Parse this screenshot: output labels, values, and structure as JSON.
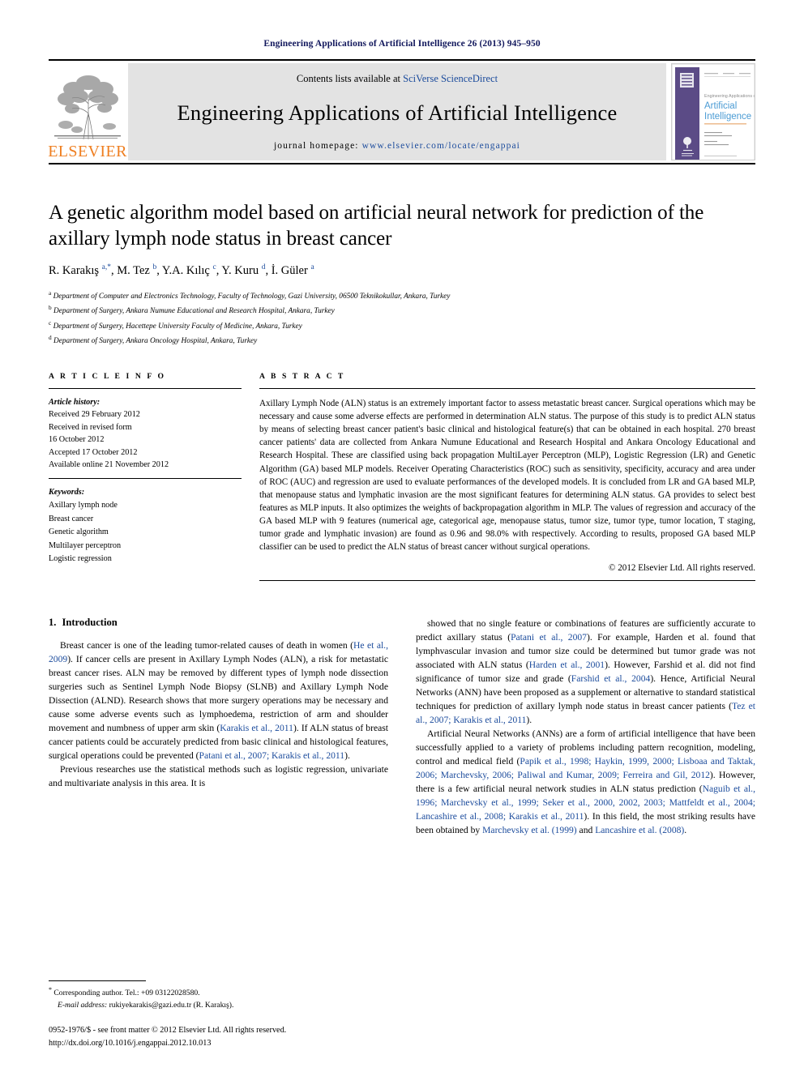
{
  "running_head": "Engineering Applications of Artificial Intelligence 26 (2013) 945–950",
  "masthead": {
    "publisher_logo_text": "ELSEVIER",
    "contents_prefix": "Contents lists available at ",
    "contents_link": "SciVerse ScienceDirect",
    "journal_title": "Engineering Applications of Artificial Intelligence",
    "homepage_prefix": "journal homepage: ",
    "homepage_url": "www.elsevier.com/locate/engappai",
    "cover": {
      "line1": "Engineering Applications of",
      "line2": "Artificial",
      "line3": "Intelligence",
      "accent_color": "#5b4b86",
      "title_color": "#4a9bd4"
    }
  },
  "article": {
    "title": "A genetic algorithm model based on artificial neural network for prediction of the axillary lymph node status in breast cancer",
    "authors_html": "R. Karakış <sup>a,*</sup>, M. Tez <sup>b</sup>, Y.A. Kılıç <sup>c</sup>, Y. Kuru <sup>d</sup>, İ. Güler <sup>a</sup>",
    "affiliations": [
      {
        "marker": "a",
        "text": "Department of Computer and Electronics Technology, Faculty of Technology, Gazi University, 06500 Teknikokullar, Ankara, Turkey"
      },
      {
        "marker": "b",
        "text": "Department of Surgery, Ankara Numune Educational and Research Hospital, Ankara, Turkey"
      },
      {
        "marker": "c",
        "text": "Department of Surgery, Hacettepe University Faculty of Medicine, Ankara, Turkey"
      },
      {
        "marker": "d",
        "text": "Department of Surgery, Ankara Oncology Hospital, Ankara, Turkey"
      }
    ]
  },
  "article_info": {
    "heading": "A R T I C L E   I N F O",
    "history_label": "Article history:",
    "history": [
      "Received 29 February 2012",
      "Received in revised form",
      "16 October 2012",
      "Accepted 17 October 2012",
      "Available online 21 November 2012"
    ],
    "keywords_label": "Keywords:",
    "keywords": [
      "Axillary lymph node",
      "Breast cancer",
      "Genetic algorithm",
      "Multilayer perceptron",
      "Logistic regression"
    ]
  },
  "abstract": {
    "heading": "A B S T R A C T",
    "text": "Axillary Lymph Node (ALN) status is an extremely important factor to assess metastatic breast cancer. Surgical operations which may be necessary and cause some adverse effects are performed in determination ALN status. The purpose of this study is to predict ALN status by means of selecting breast cancer patient's basic clinical and histological feature(s) that can be obtained in each hospital. 270 breast cancer patients' data are collected from Ankara Numune Educational and Research Hospital and Ankara Oncology Educational and Research Hospital. These are classified using back propagation MultiLayer Perceptron (MLP), Logistic Regression (LR) and Genetic Algorithm (GA) based MLP models. Receiver Operating Characteristics (ROC) such as sensitivity, specificity, accuracy and area under of ROC (AUC) and regression are used to evaluate performances of the developed models. It is concluded from LR and GA based MLP, that menopause status and lymphatic invasion are the most significant features for determining ALN status. GA provides to select best features as MLP inputs. It also optimizes the weights of backpropagation algorithm in MLP. The values of regression and accuracy of the GA based MLP with 9 features (numerical age, categorical age, menopause status, tumor size, tumor type, tumor location, T staging, tumor grade and lymphatic invasion) are found as 0.96 and 98.0% with respectively. According to results, proposed GA based MLP classifier can be used to predict the ALN status of breast cancer without surgical operations.",
    "copyright": "© 2012 Elsevier Ltd. All rights reserved."
  },
  "introduction": {
    "number": "1.",
    "title": "Introduction",
    "left_paragraphs_html": [
      "Breast cancer is one of the leading tumor-related causes of death in women (<span class=\"cite\">He et al., 2009</span>). If cancer cells are present in Axillary Lymph Nodes (ALN), a risk for metastatic breast cancer rises. ALN may be removed by different types of lymph node dissection surgeries such as Sentinel Lymph Node Biopsy (SLNB) and Axillary Lymph Node Dissection (ALND). Research shows that more surgery operations may be necessary and cause some adverse events such as lymphoedema, restriction of arm and shoulder movement and numbness of upper arm skin (<span class=\"cite\">Karakis et al., 2011</span>). If ALN status of breast cancer patients could be accurately predicted from basic clinical and histological features, surgical operations could be prevented (<span class=\"cite\">Patani et al., 2007; Karakis et al., 2011</span>).",
      "Previous researches use the statistical methods such as logistic regression, univariate and multivariate analysis in this area. It is"
    ],
    "right_paragraphs_html": [
      "showed that no single feature or combinations of features are sufficiently accurate to predict axillary status (<span class=\"cite\">Patani et al., 2007</span>). For example, Harden et al. found that lymphvascular invasion and tumor size could be determined but tumor grade was not associated with ALN status (<span class=\"cite\">Harden et al., 2001</span>). However, Farshid et al. did not find significance of tumor size and grade (<span class=\"cite\">Farshid et al., 2004</span>). Hence, Artificial Neural Networks (ANN) have been proposed as a supplement or alternative to standard statistical techniques for prediction of axillary lymph node status in breast cancer patients (<span class=\"cite\">Tez et al., 2007; Karakis et al., 2011</span>).",
      "Artificial Neural Networks (ANNs) are a form of artificial intelligence that have been successfully applied to a variety of problems including pattern recognition, modeling, control and medical field (<span class=\"cite\">Papik et al., 1998; Haykin, 1999, 2000; Lisboaa and Taktak, 2006; Marchevsky, 2006; Paliwal and Kumar, 2009; Ferreira and Gil, 2012</span>). However, there is a few artificial neural network studies in ALN status prediction (<span class=\"cite\">Naguib et al., 1996; Marchevsky et al., 1999; Seker et al., 2000, 2002, 2003; Mattfeldt et al., 2004; Lancashire et al., 2008; Karakis et al., 2011</span>). In this field, the most striking results have been obtained by <span class=\"cite\">Marchevsky et al. (1999)</span> and <span class=\"cite\">Lancashire et al. (2008)</span>."
    ]
  },
  "footnotes": {
    "corresponding_html": "<sup>*</sup> Corresponding author. Tel.: +09 03122028580.",
    "email_html": "<i>E-mail address:</i> rukiyekarakis@gazi.edu.tr (R. Karakış).",
    "imprint_line1": "0952-1976/$ - see front matter © 2012 Elsevier Ltd. All rights reserved.",
    "imprint_line2": "http://dx.doi.org/10.1016/j.engappai.2012.10.013"
  }
}
